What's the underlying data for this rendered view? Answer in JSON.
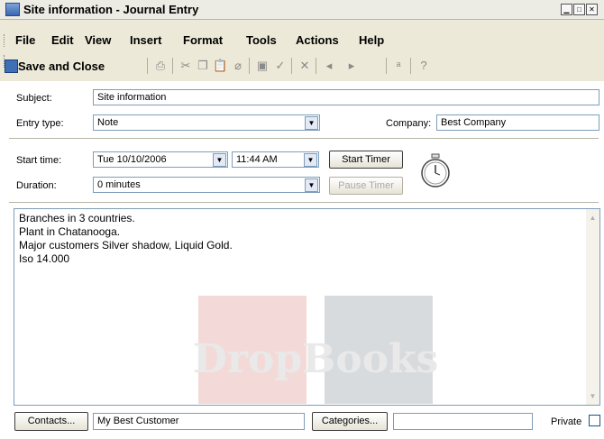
{
  "window": {
    "title": "Site information - Journal Entry"
  },
  "menu": {
    "file": "File",
    "edit": "Edit",
    "view": "View",
    "insert": "Insert",
    "format": "Format",
    "tools": "Tools",
    "actions": "Actions",
    "help": "Help"
  },
  "toolbar": {
    "save_close": "Save and Close"
  },
  "form": {
    "subject_label": "Subject:",
    "subject_value": "Site information",
    "entry_type_label": "Entry type:",
    "entry_type_value": "Note",
    "company_label": "Company:",
    "company_value": "Best Company",
    "start_time_label": "Start time:",
    "start_date_value": "Tue 10/10/2006",
    "start_clock_value": "11:44 AM",
    "start_timer_label": "Start Timer",
    "duration_label": "Duration:",
    "duration_value": "0 minutes",
    "pause_timer_label": "Pause Timer"
  },
  "notes": {
    "lines": [
      "Branches in 3 countries.",
      "Plant in Chatanooga.",
      "Major customers Silver shadow, Liquid Gold.",
      "Iso 14.000"
    ]
  },
  "footer": {
    "contacts_label": "Contacts...",
    "contacts_value": "My Best Customer",
    "categories_label": "Categories...",
    "categories_value": "",
    "private_label": "Private"
  },
  "watermark": {
    "text": "DropBooks"
  }
}
